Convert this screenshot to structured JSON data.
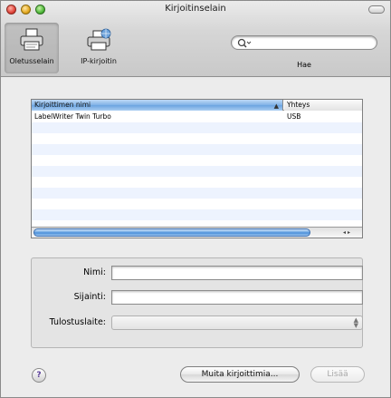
{
  "window": {
    "title": "Kirjoitinselain"
  },
  "toolbar": {
    "default_browser_label": "Oletusselain",
    "ip_printer_label": "IP-kirjoitin",
    "search_placeholder": "",
    "search_label": "Hae"
  },
  "printer_list": {
    "columns": [
      "Kirjoittimen nimi",
      "Yhteys"
    ],
    "sorted_column_arrow": "▲",
    "rows": [
      {
        "name": "LabelWriter Twin Turbo",
        "connection": "USB"
      },
      {
        "name": "",
        "connection": ""
      },
      {
        "name": "",
        "connection": ""
      },
      {
        "name": "",
        "connection": ""
      },
      {
        "name": "",
        "connection": ""
      },
      {
        "name": "",
        "connection": ""
      },
      {
        "name": "",
        "connection": ""
      },
      {
        "name": "",
        "connection": ""
      },
      {
        "name": "",
        "connection": ""
      },
      {
        "name": "",
        "connection": ""
      }
    ],
    "scroll_arrows": "◂ ▸"
  },
  "details": {
    "name_label": "Nimi:",
    "name_value": "",
    "location_label": "Sijainti:",
    "location_value": "",
    "print_using_label": "Tulostuslaite:",
    "print_using_value": ""
  },
  "footer": {
    "help_symbol": "?",
    "more_printers_label": "Muita kirjoittimia...",
    "add_label": "Lisää"
  },
  "colors": {
    "selection_header": "#7fb1e6",
    "stripe": "#edf3fe"
  }
}
